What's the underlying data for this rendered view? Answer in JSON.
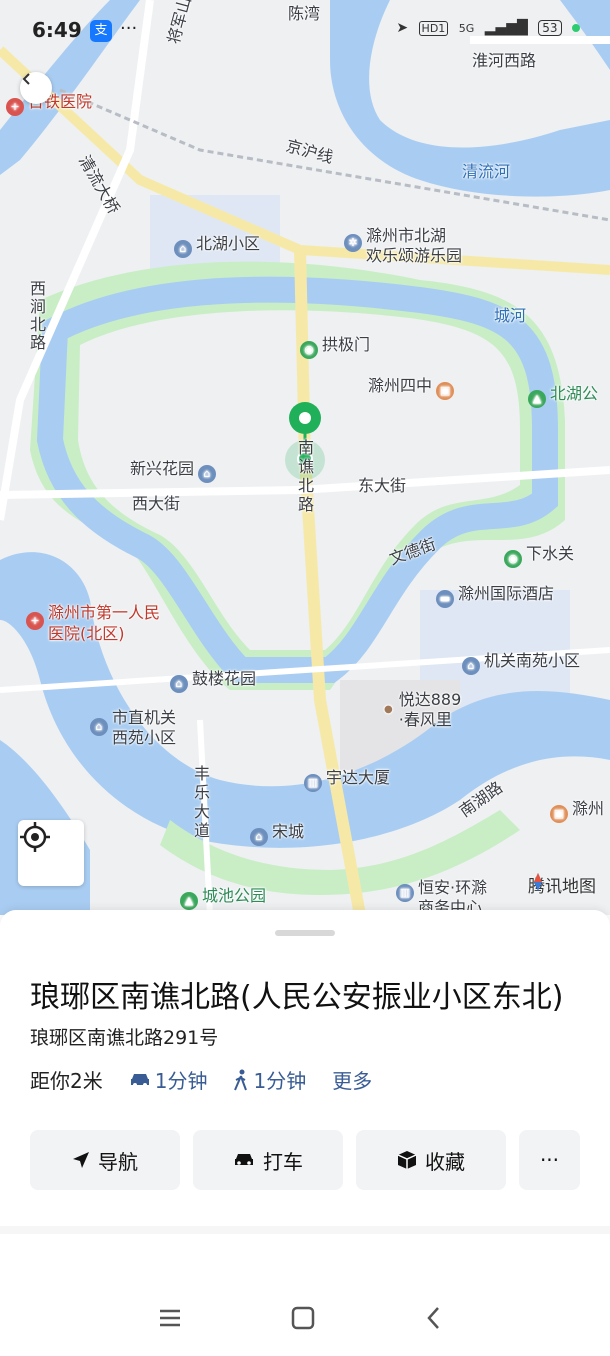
{
  "status": {
    "time": "6:49",
    "alipay": "支",
    "dots": "···",
    "hd": "HD1",
    "network": "5G",
    "battery": "53"
  },
  "map": {
    "labels": {
      "huaihe_west_rd": "淮河西路",
      "jianghu_line": "京沪线",
      "qingliu_river": "清流河",
      "chenwan": "陈湾",
      "jiangjunshan_rd": "将军山路",
      "qingliu_bridge": "清流大桥",
      "beihu_xiaoqu": "北湖小区",
      "chuzhou_park": "滁州市北湖欢乐颂游乐园",
      "chuzhou_park_l1": "滁州市北湖",
      "chuzhou_park_l2": "欢乐颂游乐园",
      "xijian_north_rd": "西涧北路",
      "city_moat": "城河",
      "gongjimen": "拱极门",
      "chuzhou_no4": "滁州四中",
      "beihu_park": "北湖公",
      "xinxing_garden": "新兴花园",
      "nanqiao_north_rd": "南谯北路",
      "east_street": "东大街",
      "west_street": "西大街",
      "wende_street": "文德街",
      "xiashuiguan": "下水关",
      "first_hospital_l1": "滁州市第一人民",
      "first_hospital_l2": "医院(北区)",
      "intl_hotel": "滁州国际酒店",
      "gulou_garden": "鼓楼花园",
      "jiguan_nanyuan": "机关南苑小区",
      "yueda_l1": "悦达889",
      "yueda_l2": "·春风里",
      "shizhi_l1": "市直机关",
      "shizhi_l2": "西苑小区",
      "yuda_tower": "宇达大厦",
      "fengle_road": "丰乐大道",
      "songcheng": "宋城",
      "nanhu_rd": "南湖路",
      "chuzhou_right": "滁州",
      "chengchi_park": "城池公园",
      "hengan_l1": "恒安·环滁",
      "hengan_l2": "商务中心",
      "hospital_top": "台铁医院"
    },
    "brand": "腾讯地图"
  },
  "place": {
    "title": "琅琊区南谯北路(人民公安振业小区东北)",
    "address": "琅琊区南谯北路291号",
    "distance": "距你2米",
    "drive_time": "1分钟",
    "walk_time": "1分钟",
    "more": "更多"
  },
  "actions": {
    "navigate": "导航",
    "taxi": "打车",
    "favorite": "收藏",
    "more": "···"
  },
  "colors": {
    "water": "#a9cdf2",
    "park": "#c9eec6",
    "pin": "#20b05a",
    "accent": "#3a5c94"
  }
}
